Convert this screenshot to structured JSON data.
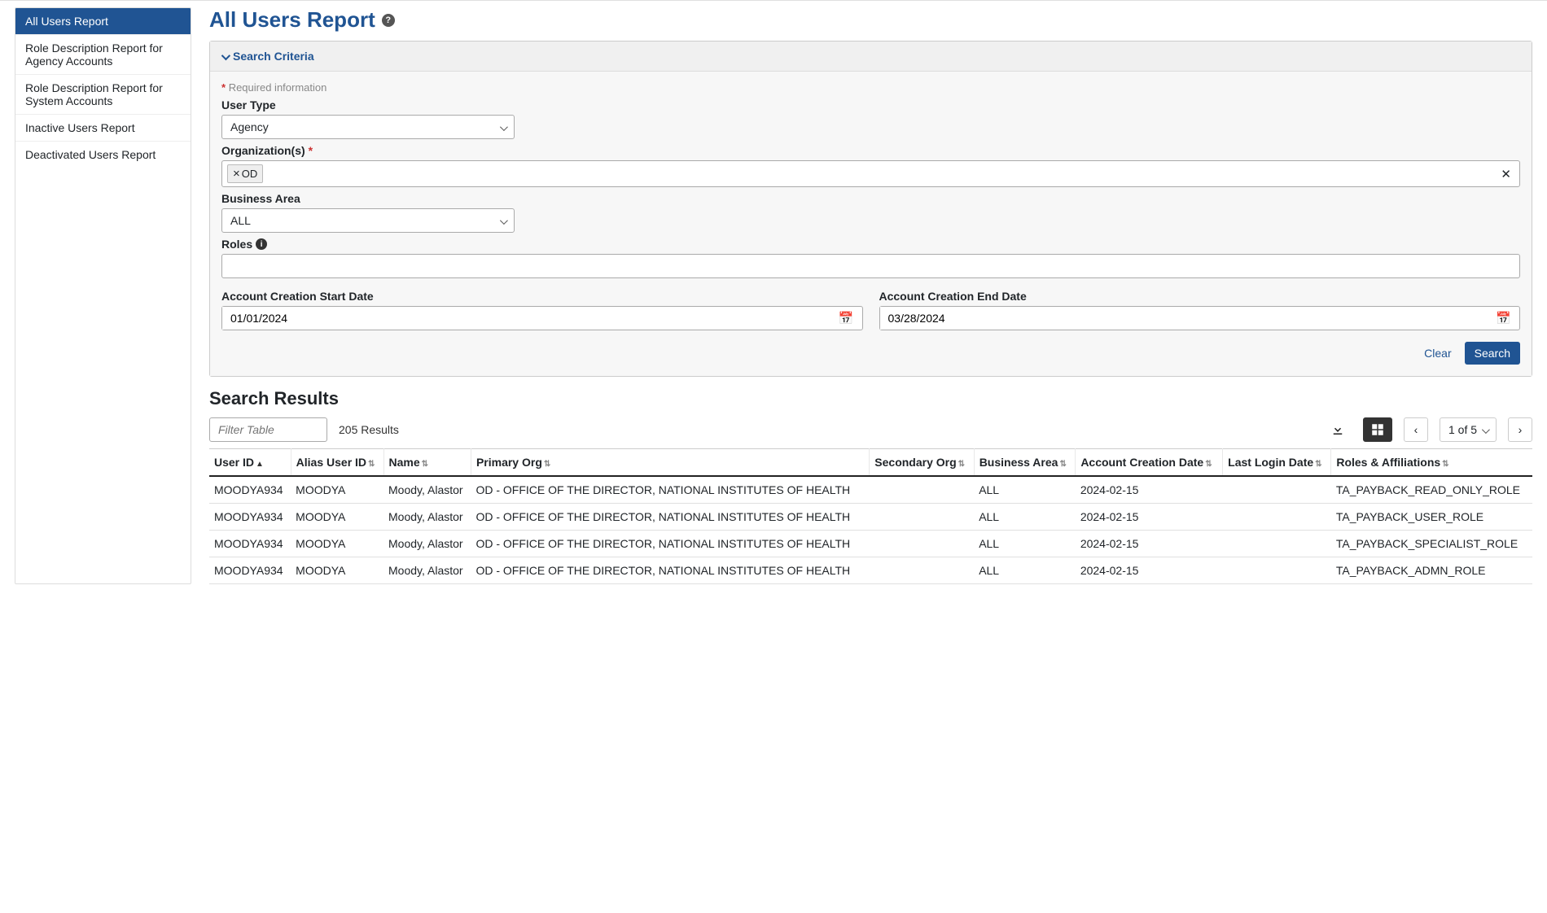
{
  "sidebar": {
    "items": [
      "All Users Report",
      "Role Description Report for Agency Accounts",
      "Role Description Report for System Accounts",
      "Inactive Users Report",
      "Deactivated Users Report"
    ]
  },
  "page_title": "All Users Report",
  "search_panel": {
    "header": "Search Criteria",
    "required_note": "Required information",
    "labels": {
      "user_type": "User Type",
      "organizations": "Organization(s)",
      "business_area": "Business Area",
      "roles": "Roles",
      "start_date": "Account Creation Start Date",
      "end_date": "Account Creation End Date"
    },
    "values": {
      "user_type": "Agency",
      "org_tag": "OD",
      "business_area": "ALL",
      "start_date": "01/01/2024",
      "end_date": "03/28/2024"
    },
    "buttons": {
      "clear": "Clear",
      "search": "Search"
    }
  },
  "results": {
    "title": "Search Results",
    "filter_placeholder": "Filter Table",
    "count_text": "205 Results",
    "page_label": "1 of 5",
    "columns": [
      "User ID",
      "Alias User ID",
      "Name",
      "Primary Org",
      "Secondary Org",
      "Business Area",
      "Account Creation Date",
      "Last Login Date",
      "Roles & Affiliations"
    ],
    "rows": [
      {
        "user_id": "MOODYA934",
        "alias": "MOODYA",
        "name": "Moody, Alastor",
        "primary_org": "OD - OFFICE OF THE DIRECTOR, NATIONAL INSTITUTES OF HEALTH",
        "secondary_org": "",
        "business_area": "ALL",
        "creation_date": "2024-02-15",
        "last_login": "",
        "roles": "TA_PAYBACK_READ_ONLY_ROLE"
      },
      {
        "user_id": "MOODYA934",
        "alias": "MOODYA",
        "name": "Moody, Alastor",
        "primary_org": "OD - OFFICE OF THE DIRECTOR, NATIONAL INSTITUTES OF HEALTH",
        "secondary_org": "",
        "business_area": "ALL",
        "creation_date": "2024-02-15",
        "last_login": "",
        "roles": "TA_PAYBACK_USER_ROLE"
      },
      {
        "user_id": "MOODYA934",
        "alias": "MOODYA",
        "name": "Moody, Alastor",
        "primary_org": "OD - OFFICE OF THE DIRECTOR, NATIONAL INSTITUTES OF HEALTH",
        "secondary_org": "",
        "business_area": "ALL",
        "creation_date": "2024-02-15",
        "last_login": "",
        "roles": "TA_PAYBACK_SPECIALIST_ROLE"
      },
      {
        "user_id": "MOODYA934",
        "alias": "MOODYA",
        "name": "Moody, Alastor",
        "primary_org": "OD - OFFICE OF THE DIRECTOR, NATIONAL INSTITUTES OF HEALTH",
        "secondary_org": "",
        "business_area": "ALL",
        "creation_date": "2024-02-15",
        "last_login": "",
        "roles": "TA_PAYBACK_ADMN_ROLE"
      }
    ]
  }
}
